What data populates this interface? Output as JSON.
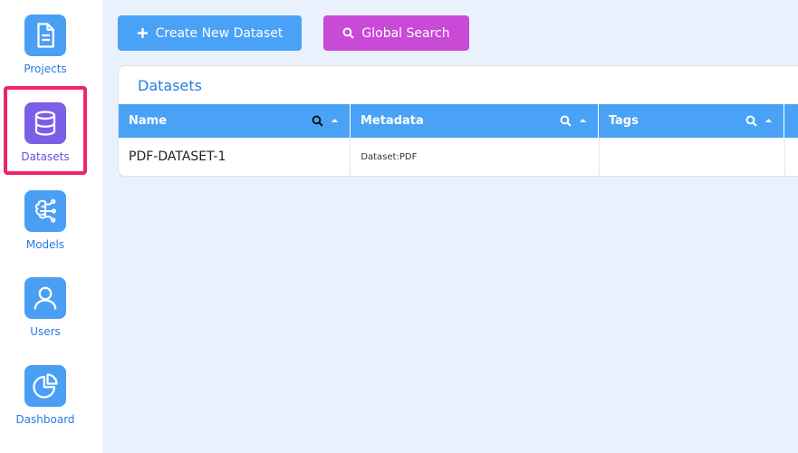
{
  "sidebar": {
    "items": [
      {
        "label": "Projects",
        "icon": "file-icon"
      },
      {
        "label": "Datasets",
        "icon": "database-icon",
        "active": true
      },
      {
        "label": "Models",
        "icon": "brain-circuit-icon"
      },
      {
        "label": "Users",
        "icon": "user-icon"
      },
      {
        "label": "Dashboard",
        "icon": "pie-chart-icon"
      }
    ]
  },
  "toolbar": {
    "create_label": "Create New Dataset",
    "search_label": "Global Search"
  },
  "panel": {
    "title": "Datasets",
    "columns": [
      "Name",
      "Metadata",
      "Tags"
    ],
    "rows": [
      {
        "name": "PDF-DATASET-1",
        "metadata": "Dataset:PDF",
        "tags": ""
      }
    ]
  },
  "colors": {
    "accent": "#4aa2f7",
    "active": "#7b5fe8",
    "highlight": "#f0246a",
    "search_button": "#c94ad6"
  }
}
